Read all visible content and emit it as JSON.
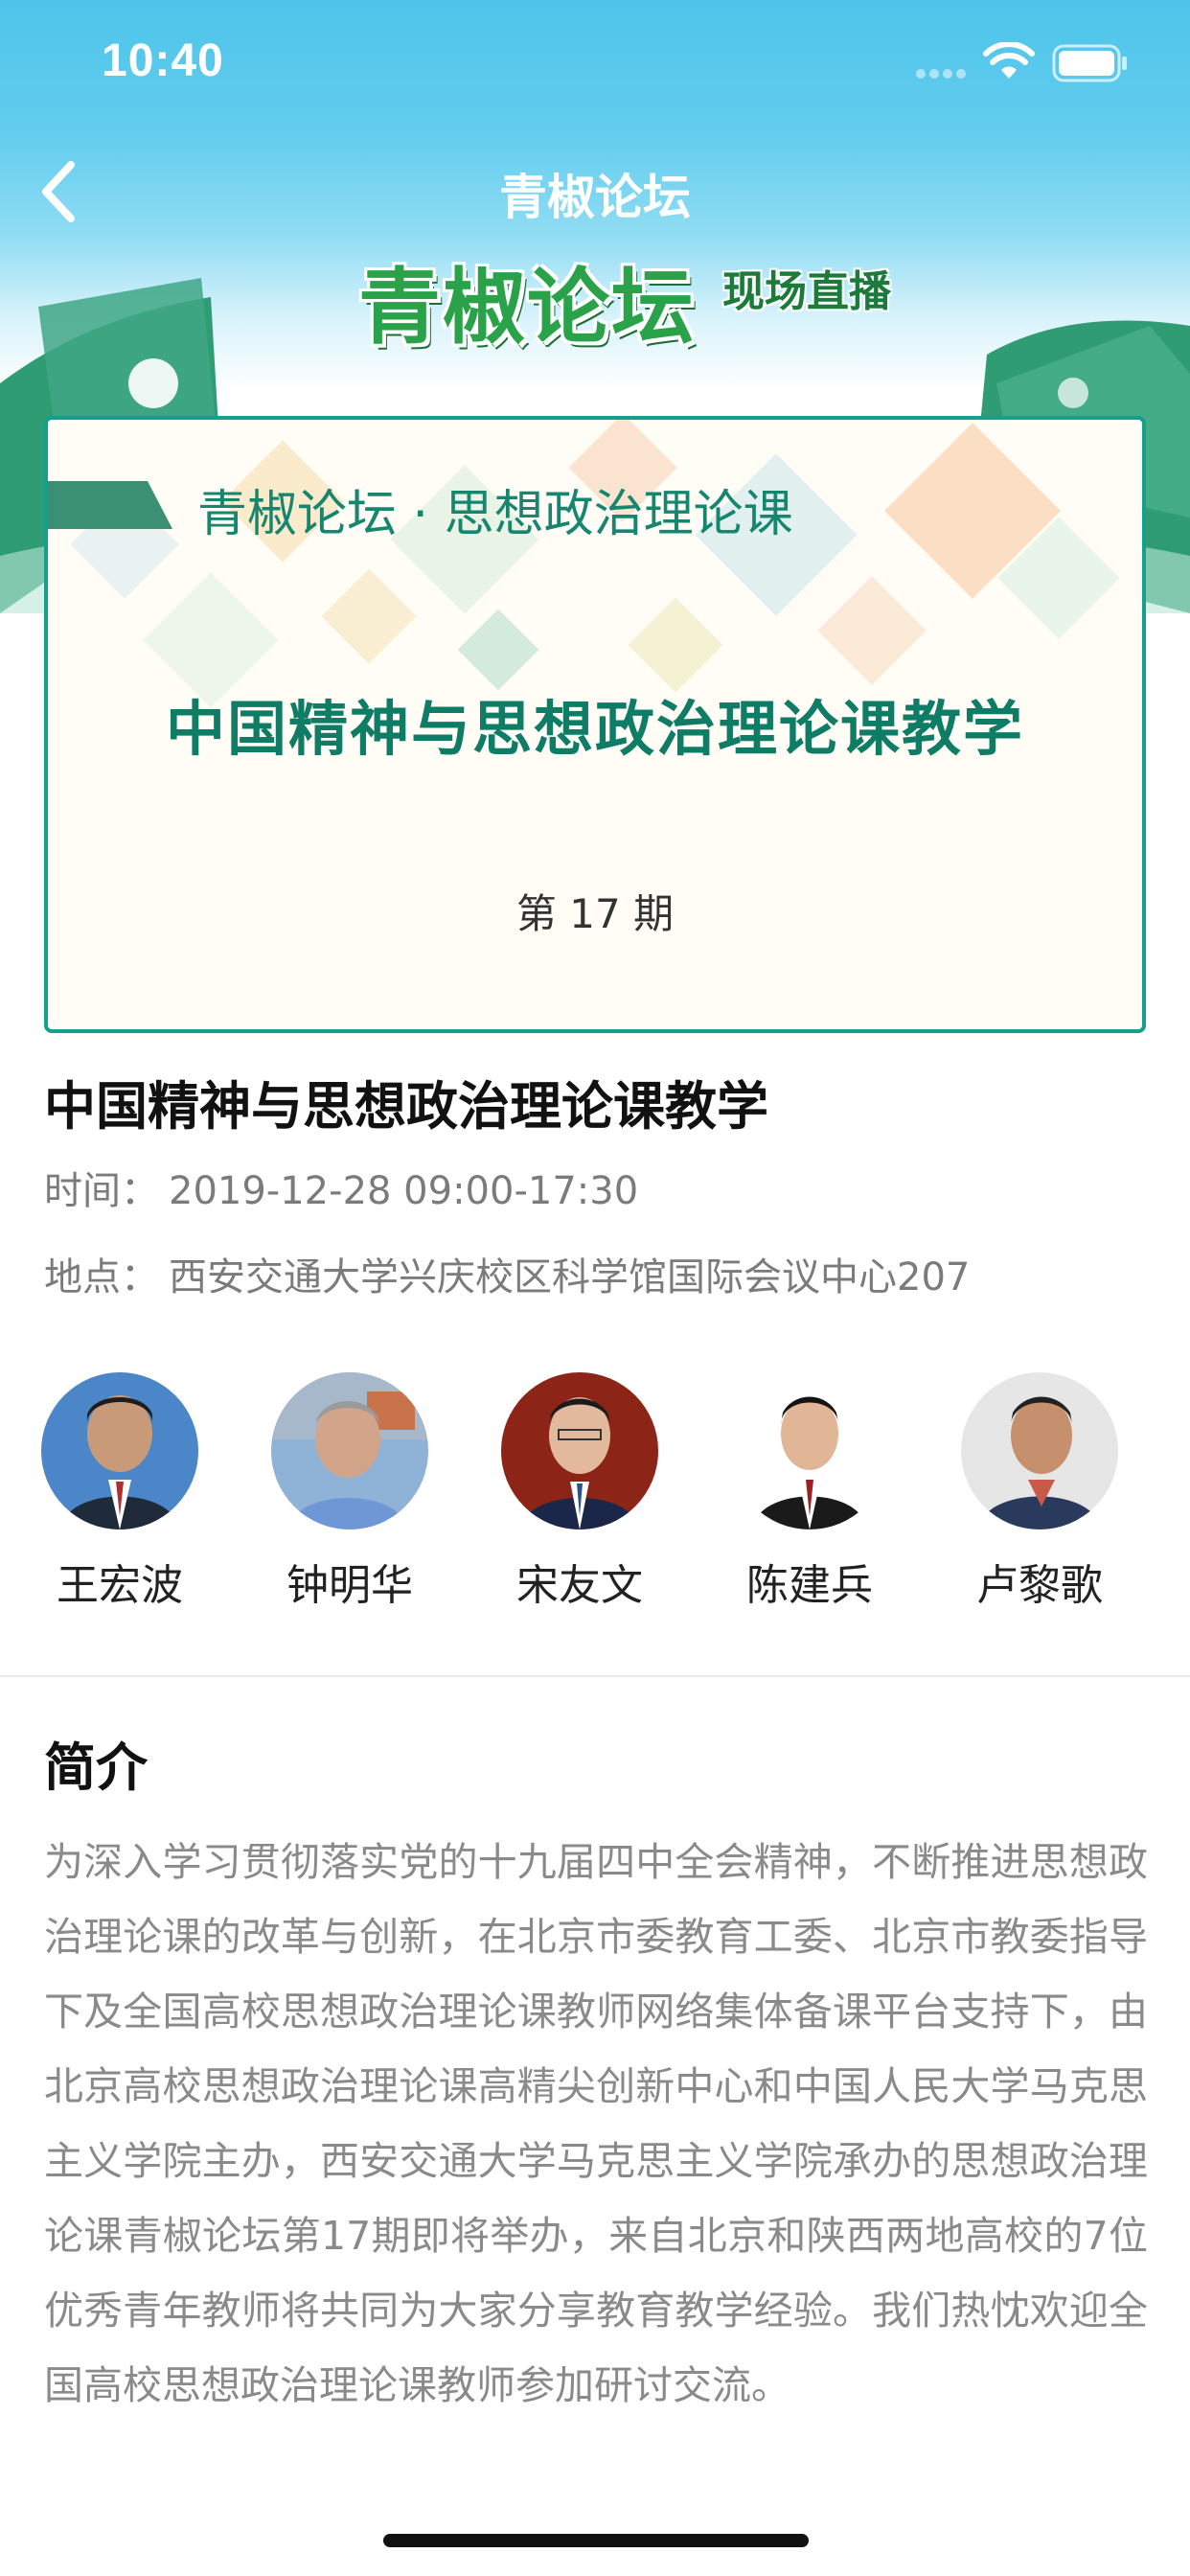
{
  "status_bar": {
    "time": "10:40"
  },
  "nav": {
    "title": "青椒论坛"
  },
  "logo": {
    "main": "青椒论坛",
    "sub": "现场直播"
  },
  "banner": {
    "subtitle": "青椒论坛 · 思想政治理论课",
    "title": "中国精神与思想政治理论课教学",
    "issue": "第 17 期"
  },
  "event": {
    "title": "中国精神与思想政治理论课教学",
    "time_label": "时间：",
    "time_value": "2019-12-28 09:00-17:30",
    "place_label": "地点：",
    "place_value": "西安交通大学兴庆校区科学馆国际会议中心207"
  },
  "speakers": [
    {
      "name": "王宏波"
    },
    {
      "name": "钟明华"
    },
    {
      "name": "宋友文"
    },
    {
      "name": "陈建兵"
    },
    {
      "name": "卢黎歌"
    }
  ],
  "intro": {
    "heading": "简介",
    "text": "为深入学习贯彻落实党的十九届四中全会精神，不断推进思想政治理论课的改革与创新，在北京市委教育工委、北京市教委指导下及全国高校思想政治理论课教师网络集体备课平台支持下，由北京高校思想政治理论课高精尖创新中心和中国人民大学马克思主义学院主办，西安交通大学马克思主义学院承办的思想政治理论课青椒论坛第17期即将举办，来自北京和陕西两地高校的7位优秀青年教师将共同为大家分享教育教学经验。我们热忱欢迎全国高校思想政治理论课教师参加研讨交流。"
  },
  "colors": {
    "header_blue": "#4ec4ea",
    "accent_green": "#14a08a",
    "title_green": "#0f7d66",
    "logo_green": "#2aa24a"
  }
}
